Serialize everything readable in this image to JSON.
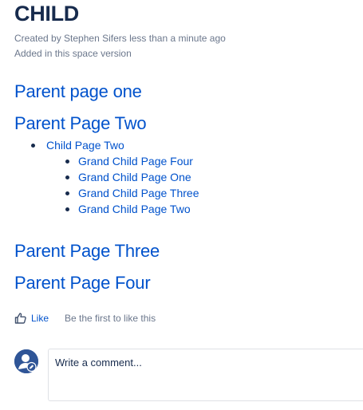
{
  "page": {
    "title": "CHILD",
    "meta_created": "Created by Stephen Sifers less than a minute ago",
    "meta_added": "Added in this space version"
  },
  "tree": {
    "parents": [
      {
        "label": "Parent page one"
      },
      {
        "label": "Parent Page Two"
      },
      {
        "label": "Parent Page Three"
      },
      {
        "label": "Parent Page Four"
      }
    ],
    "child": {
      "label": "Child Page Two"
    },
    "grandchildren": [
      {
        "label": "Grand Child Page Four"
      },
      {
        "label": "Grand Child Page One"
      },
      {
        "label": "Grand Child Page Three"
      },
      {
        "label": "Grand Child Page Two"
      }
    ]
  },
  "like": {
    "icon": "thumbs-up-icon",
    "label": "Like",
    "hint": "Be the first to like this"
  },
  "comment": {
    "avatar_icon": "default-user-avatar-icon",
    "placeholder": "Write a comment..."
  },
  "colors": {
    "link": "#0052cc",
    "text": "#172b4d",
    "muted": "#6b778c",
    "avatar": "#2f5597"
  }
}
